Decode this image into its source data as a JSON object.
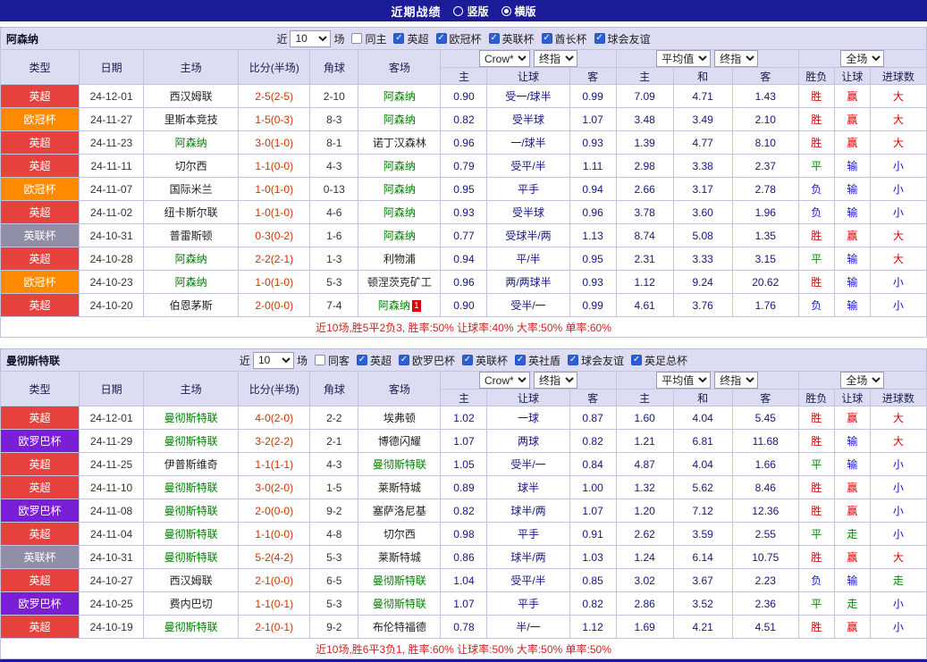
{
  "title_bar": {
    "title": "近期战绩",
    "radios": [
      {
        "label": "竖版",
        "selected": false
      },
      {
        "label": "横版",
        "selected": true
      }
    ]
  },
  "table_header": {
    "static_cols": [
      "类型",
      "日期",
      "主场",
      "比分(半场)",
      "角球",
      "客场"
    ],
    "groups": [
      {
        "selects": [
          "Crow*",
          "终指"
        ],
        "cols": [
          "主",
          "让球",
          "客"
        ]
      },
      {
        "selects": [
          "平均值",
          "终指"
        ],
        "cols": [
          "主",
          "和",
          "客"
        ]
      },
      {
        "selects": [
          "全场"
        ],
        "cols": [
          "胜负",
          "让球",
          "进球数"
        ]
      }
    ]
  },
  "colors": {
    "title_bar_bg": "#1c1c99",
    "header_bg": "#dcdcf2",
    "league": {
      "英超": "#e8423e",
      "欧冠杯": "#ff8a00",
      "英联杯": "#8f8fa8",
      "欧罗巴杯": "#7b1fd6"
    },
    "result": {
      "胜": "#e00000",
      "赢": "#e00000",
      "大": "#e00000",
      "负": "#1414cc",
      "输": "#1414cc",
      "小": "#1414cc",
      "平": "#008800",
      "走": "#008800"
    },
    "focus_team": "#008000",
    "score": "#cc3300",
    "odds": "#16167e",
    "summary_text": "#cc2222"
  },
  "sections": [
    {
      "team": "阿森纳",
      "filter": {
        "near_label": "近",
        "count": "10",
        "matches_label": "场",
        "same": {
          "label": "同主",
          "checked": false
        },
        "leagues": [
          {
            "label": "英超",
            "checked": true
          },
          {
            "label": "欧冠杯",
            "checked": true
          },
          {
            "label": "英联杯",
            "checked": true
          },
          {
            "label": "酋长杯",
            "checked": true
          },
          {
            "label": "球会友谊",
            "checked": true
          }
        ]
      },
      "rows": [
        {
          "league": "英超",
          "date": "24-12-01",
          "home": "西汉姆联",
          "home_focus": false,
          "score": "2-5(2-5)",
          "corners": "2-10",
          "away": "阿森纳",
          "away_focus": true,
          "asia": [
            "0.90",
            "受一/球半",
            "0.99"
          ],
          "euro": [
            "7.09",
            "4.71",
            "1.43"
          ],
          "results": [
            "胜",
            "赢",
            "大"
          ]
        },
        {
          "league": "欧冠杯",
          "date": "24-11-27",
          "home": "里斯本竞技",
          "home_focus": false,
          "score": "1-5(0-3)",
          "corners": "8-3",
          "away": "阿森纳",
          "away_focus": true,
          "asia": [
            "0.82",
            "受半球",
            "1.07"
          ],
          "euro": [
            "3.48",
            "3.49",
            "2.10"
          ],
          "results": [
            "胜",
            "赢",
            "大"
          ]
        },
        {
          "league": "英超",
          "date": "24-11-23",
          "home": "阿森纳",
          "home_focus": true,
          "score": "3-0(1-0)",
          "corners": "8-1",
          "away": "诺丁汉森林",
          "away_focus": false,
          "asia": [
            "0.96",
            "一/球半",
            "0.93"
          ],
          "euro": [
            "1.39",
            "4.77",
            "8.10"
          ],
          "results": [
            "胜",
            "赢",
            "大"
          ]
        },
        {
          "league": "英超",
          "date": "24-11-11",
          "home": "切尔西",
          "home_focus": false,
          "score": "1-1(0-0)",
          "corners": "4-3",
          "away": "阿森纳",
          "away_focus": true,
          "asia": [
            "0.79",
            "受平/半",
            "1.11"
          ],
          "euro": [
            "2.98",
            "3.38",
            "2.37"
          ],
          "results": [
            "平",
            "输",
            "小"
          ]
        },
        {
          "league": "欧冠杯",
          "date": "24-11-07",
          "home": "国际米兰",
          "home_focus": false,
          "score": "1-0(1-0)",
          "corners": "0-13",
          "away": "阿森纳",
          "away_focus": true,
          "asia": [
            "0.95",
            "平手",
            "0.94"
          ],
          "euro": [
            "2.66",
            "3.17",
            "2.78"
          ],
          "results": [
            "负",
            "输",
            "小"
          ]
        },
        {
          "league": "英超",
          "date": "24-11-02",
          "home": "纽卡斯尔联",
          "home_focus": false,
          "score": "1-0(1-0)",
          "corners": "4-6",
          "away": "阿森纳",
          "away_focus": true,
          "asia": [
            "0.93",
            "受半球",
            "0.96"
          ],
          "euro": [
            "3.78",
            "3.60",
            "1.96"
          ],
          "results": [
            "负",
            "输",
            "小"
          ]
        },
        {
          "league": "英联杯",
          "date": "24-10-31",
          "home": "普雷斯顿",
          "home_focus": false,
          "score": "0-3(0-2)",
          "corners": "1-6",
          "away": "阿森纳",
          "away_focus": true,
          "asia": [
            "0.77",
            "受球半/两",
            "1.13"
          ],
          "euro": [
            "8.74",
            "5.08",
            "1.35"
          ],
          "results": [
            "胜",
            "赢",
            "大"
          ]
        },
        {
          "league": "英超",
          "date": "24-10-28",
          "home": "阿森纳",
          "home_focus": true,
          "score": "2-2(2-1)",
          "corners": "1-3",
          "away": "利物浦",
          "away_focus": false,
          "asia": [
            "0.94",
            "平/半",
            "0.95"
          ],
          "euro": [
            "2.31",
            "3.33",
            "3.15"
          ],
          "results": [
            "平",
            "输",
            "大"
          ]
        },
        {
          "league": "欧冠杯",
          "date": "24-10-23",
          "home": "阿森纳",
          "home_focus": true,
          "score": "1-0(1-0)",
          "corners": "5-3",
          "away": "顿涅茨克矿工",
          "away_focus": false,
          "asia": [
            "0.96",
            "两/两球半",
            "0.93"
          ],
          "euro": [
            "1.12",
            "9.24",
            "20.62"
          ],
          "results": [
            "胜",
            "输",
            "小"
          ]
        },
        {
          "league": "英超",
          "date": "24-10-20",
          "home": "伯恩茅斯",
          "home_focus": false,
          "score": "2-0(0-0)",
          "corners": "7-4",
          "away": "阿森纳",
          "away_focus": true,
          "away_red_card": "1",
          "asia": [
            "0.90",
            "受半/一",
            "0.99"
          ],
          "euro": [
            "4.61",
            "3.76",
            "1.76"
          ],
          "results": [
            "负",
            "输",
            "小"
          ]
        }
      ],
      "summary": "近10场,胜5平2负3, 胜率:50% 让球率:40% 大率:50% 单率:60%"
    },
    {
      "team": "曼彻斯特联",
      "filter": {
        "near_label": "近",
        "count": "10",
        "matches_label": "场",
        "same": {
          "label": "同客",
          "checked": false
        },
        "leagues": [
          {
            "label": "英超",
            "checked": true
          },
          {
            "label": "欧罗巴杯",
            "checked": true
          },
          {
            "label": "英联杯",
            "checked": true
          },
          {
            "label": "英社盾",
            "checked": true
          },
          {
            "label": "球会友谊",
            "checked": true
          },
          {
            "label": "英足总杯",
            "checked": true
          }
        ]
      },
      "rows": [
        {
          "league": "英超",
          "date": "24-12-01",
          "home": "曼彻斯特联",
          "home_focus": true,
          "score": "4-0(2-0)",
          "corners": "2-2",
          "away": "埃弗顿",
          "away_focus": false,
          "asia": [
            "1.02",
            "一球",
            "0.87"
          ],
          "euro": [
            "1.60",
            "4.04",
            "5.45"
          ],
          "results": [
            "胜",
            "赢",
            "大"
          ]
        },
        {
          "league": "欧罗巴杯",
          "date": "24-11-29",
          "home": "曼彻斯特联",
          "home_focus": true,
          "score": "3-2(2-2)",
          "corners": "2-1",
          "away": "博德闪耀",
          "away_focus": false,
          "asia": [
            "1.07",
            "两球",
            "0.82"
          ],
          "euro": [
            "1.21",
            "6.81",
            "11.68"
          ],
          "results": [
            "胜",
            "输",
            "大"
          ]
        },
        {
          "league": "英超",
          "date": "24-11-25",
          "home": "伊普斯维奇",
          "home_focus": false,
          "score": "1-1(1-1)",
          "corners": "4-3",
          "away": "曼彻斯特联",
          "away_focus": true,
          "asia": [
            "1.05",
            "受半/一",
            "0.84"
          ],
          "euro": [
            "4.87",
            "4.04",
            "1.66"
          ],
          "results": [
            "平",
            "输",
            "小"
          ]
        },
        {
          "league": "英超",
          "date": "24-11-10",
          "home": "曼彻斯特联",
          "home_focus": true,
          "score": "3-0(2-0)",
          "corners": "1-5",
          "away": "莱斯特城",
          "away_focus": false,
          "asia": [
            "0.89",
            "球半",
            "1.00"
          ],
          "euro": [
            "1.32",
            "5.62",
            "8.46"
          ],
          "results": [
            "胜",
            "赢",
            "小"
          ]
        },
        {
          "league": "欧罗巴杯",
          "date": "24-11-08",
          "home": "曼彻斯特联",
          "home_focus": true,
          "score": "2-0(0-0)",
          "corners": "9-2",
          "away": "塞萨洛尼基",
          "away_focus": false,
          "asia": [
            "0.82",
            "球半/两",
            "1.07"
          ],
          "euro": [
            "1.20",
            "7.12",
            "12.36"
          ],
          "results": [
            "胜",
            "赢",
            "小"
          ]
        },
        {
          "league": "英超",
          "date": "24-11-04",
          "home": "曼彻斯特联",
          "home_focus": true,
          "score": "1-1(0-0)",
          "corners": "4-8",
          "away": "切尔西",
          "away_focus": false,
          "asia": [
            "0.98",
            "平手",
            "0.91"
          ],
          "euro": [
            "2.62",
            "3.59",
            "2.55"
          ],
          "results": [
            "平",
            "走",
            "小"
          ]
        },
        {
          "league": "英联杯",
          "date": "24-10-31",
          "home": "曼彻斯特联",
          "home_focus": true,
          "score": "5-2(4-2)",
          "corners": "5-3",
          "away": "莱斯特城",
          "away_focus": false,
          "asia": [
            "0.86",
            "球半/两",
            "1.03"
          ],
          "euro": [
            "1.24",
            "6.14",
            "10.75"
          ],
          "results": [
            "胜",
            "赢",
            "大"
          ]
        },
        {
          "league": "英超",
          "date": "24-10-27",
          "home": "西汉姆联",
          "home_focus": false,
          "score": "2-1(0-0)",
          "corners": "6-5",
          "away": "曼彻斯特联",
          "away_focus": true,
          "asia": [
            "1.04",
            "受平/半",
            "0.85"
          ],
          "euro": [
            "3.02",
            "3.67",
            "2.23"
          ],
          "results": [
            "负",
            "输",
            "走"
          ]
        },
        {
          "league": "欧罗巴杯",
          "date": "24-10-25",
          "home": "费内巴切",
          "home_focus": false,
          "score": "1-1(0-1)",
          "corners": "5-3",
          "away": "曼彻斯特联",
          "away_focus": true,
          "asia": [
            "1.07",
            "平手",
            "0.82"
          ],
          "euro": [
            "2.86",
            "3.52",
            "2.36"
          ],
          "results": [
            "平",
            "走",
            "小"
          ]
        },
        {
          "league": "英超",
          "date": "24-10-19",
          "home": "曼彻斯特联",
          "home_focus": true,
          "score": "2-1(0-1)",
          "corners": "9-2",
          "away": "布伦特福德",
          "away_focus": false,
          "asia": [
            "0.78",
            "半/一",
            "1.12"
          ],
          "euro": [
            "1.69",
            "4.21",
            "4.51"
          ],
          "results": [
            "胜",
            "赢",
            "小"
          ]
        }
      ],
      "summary": "近10场,胜6平3负1, 胜率:60% 让球率:50% 大率:50% 单率:50%"
    }
  ]
}
